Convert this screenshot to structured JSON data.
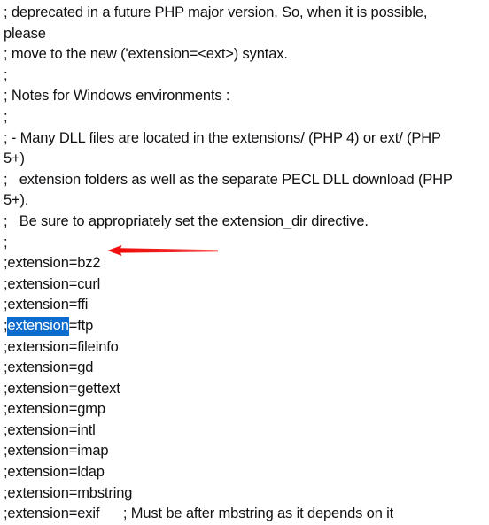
{
  "document": {
    "kind": "php-ini-configuration",
    "background_color": "#ffffff",
    "text_color": "#111114",
    "lines": [
      {
        "id": "l1",
        "text": "; deprecated in a future PHP major version. So, when it is possible,"
      },
      {
        "id": "l2",
        "text": "please"
      },
      {
        "id": "l3",
        "text": "; move to the new ('extension=<ext>) syntax."
      },
      {
        "id": "l4",
        "text": ";"
      },
      {
        "id": "l5",
        "text": "; Notes for Windows environments :"
      },
      {
        "id": "l6",
        "text": ";"
      },
      {
        "id": "l7",
        "text": "; - Many DLL files are located in the extensions/ (PHP 4) or ext/ (PHP"
      },
      {
        "id": "l8",
        "text": "5+)"
      },
      {
        "id": "l9",
        "text": ";   extension folders as well as the separate PECL DLL download (PHP"
      },
      {
        "id": "l10",
        "text": "5+)."
      },
      {
        "id": "l11",
        "text": ";   Be sure to appropriately set the extension_dir directive."
      },
      {
        "id": "l12",
        "text": ";"
      },
      {
        "id": "l13",
        "text": ";extension=bz2"
      },
      {
        "id": "l14",
        "text": ";extension=curl"
      },
      {
        "id": "l15",
        "text": ";extension=ffi"
      },
      {
        "id": "l16",
        "text": ";extension=ftp",
        "selection": {
          "before": ";",
          "selected": "extension",
          "after": "=ftp"
        }
      },
      {
        "id": "l17",
        "text": ";extension=fileinfo"
      },
      {
        "id": "l18",
        "text": ";extension=gd"
      },
      {
        "id": "l19",
        "text": ";extension=gettext"
      },
      {
        "id": "l20",
        "text": ";extension=gmp"
      },
      {
        "id": "l21",
        "text": ";extension=intl"
      },
      {
        "id": "l22",
        "text": ";extension=imap"
      },
      {
        "id": "l23",
        "text": ";extension=ldap"
      },
      {
        "id": "l24",
        "text": ";extension=mbstring"
      },
      {
        "id": "l25",
        "text": ";extension=exif      ; Must be after mbstring as it depends on it"
      }
    ]
  },
  "selection": {
    "selected_text": "extension",
    "on_line": ";extension=ftp",
    "highlight_color": "#0b6ccd",
    "highlight_text_color": "#ffffff"
  },
  "annotation": {
    "type": "arrow",
    "direction": "left",
    "color": "#ee1111",
    "points_at": ";extension=curl",
    "label": ""
  }
}
